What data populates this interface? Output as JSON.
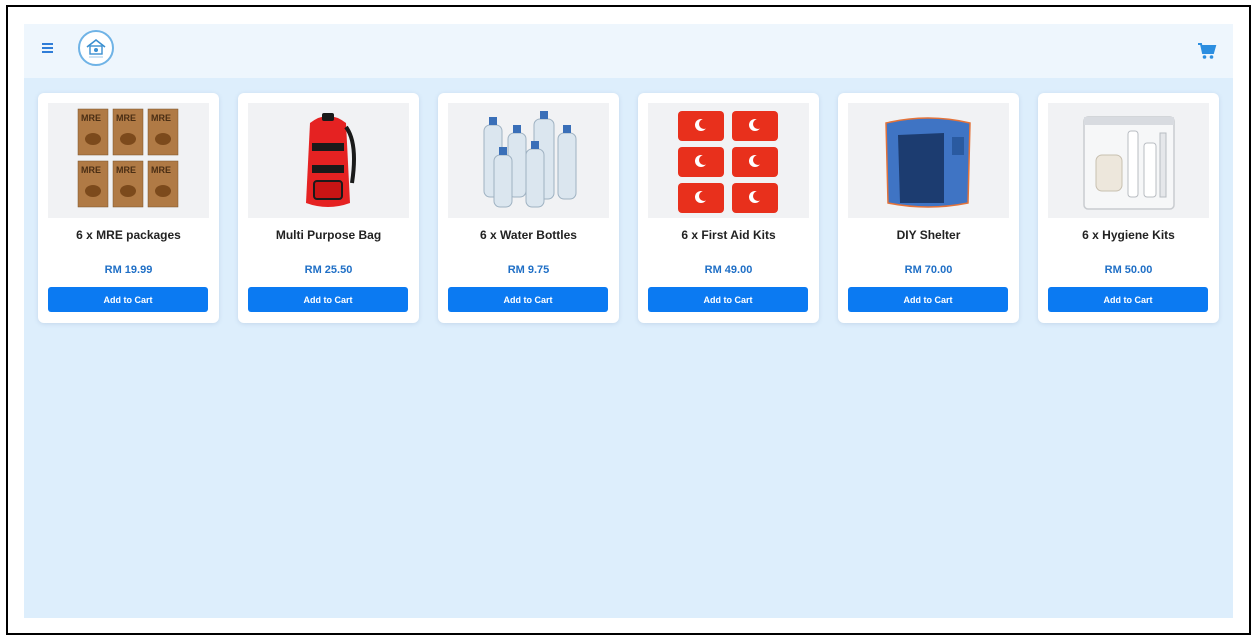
{
  "header": {
    "menu_icon": "hamburger-menu-icon",
    "logo_icon": "shop-logo-icon",
    "cart_icon": "shopping-cart-icon"
  },
  "colors": {
    "accent": "#0b7af2",
    "price": "#1f6fc6",
    "background": "#ddeefc",
    "header": "#eef6fd"
  },
  "products": [
    {
      "name": "6 x MRE packages",
      "price": "RM 19.99",
      "button": "Add to Cart",
      "image": "mre-packages-image"
    },
    {
      "name": "Multi Purpose Bag",
      "price": "RM 25.50",
      "button": "Add to Cart",
      "image": "backpack-image"
    },
    {
      "name": "6 x Water Bottles",
      "price": "RM 9.75",
      "button": "Add to Cart",
      "image": "water-bottles-image"
    },
    {
      "name": "6 x First Aid Kits",
      "price": "RM 49.00",
      "button": "Add to Cart",
      "image": "first-aid-kits-image"
    },
    {
      "name": "DIY Shelter",
      "price": "RM 70.00",
      "button": "Add to Cart",
      "image": "shelter-tent-image"
    },
    {
      "name": "6 x Hygiene Kits",
      "price": "RM 50.00",
      "button": "Add to Cart",
      "image": "hygiene-kit-image"
    }
  ]
}
